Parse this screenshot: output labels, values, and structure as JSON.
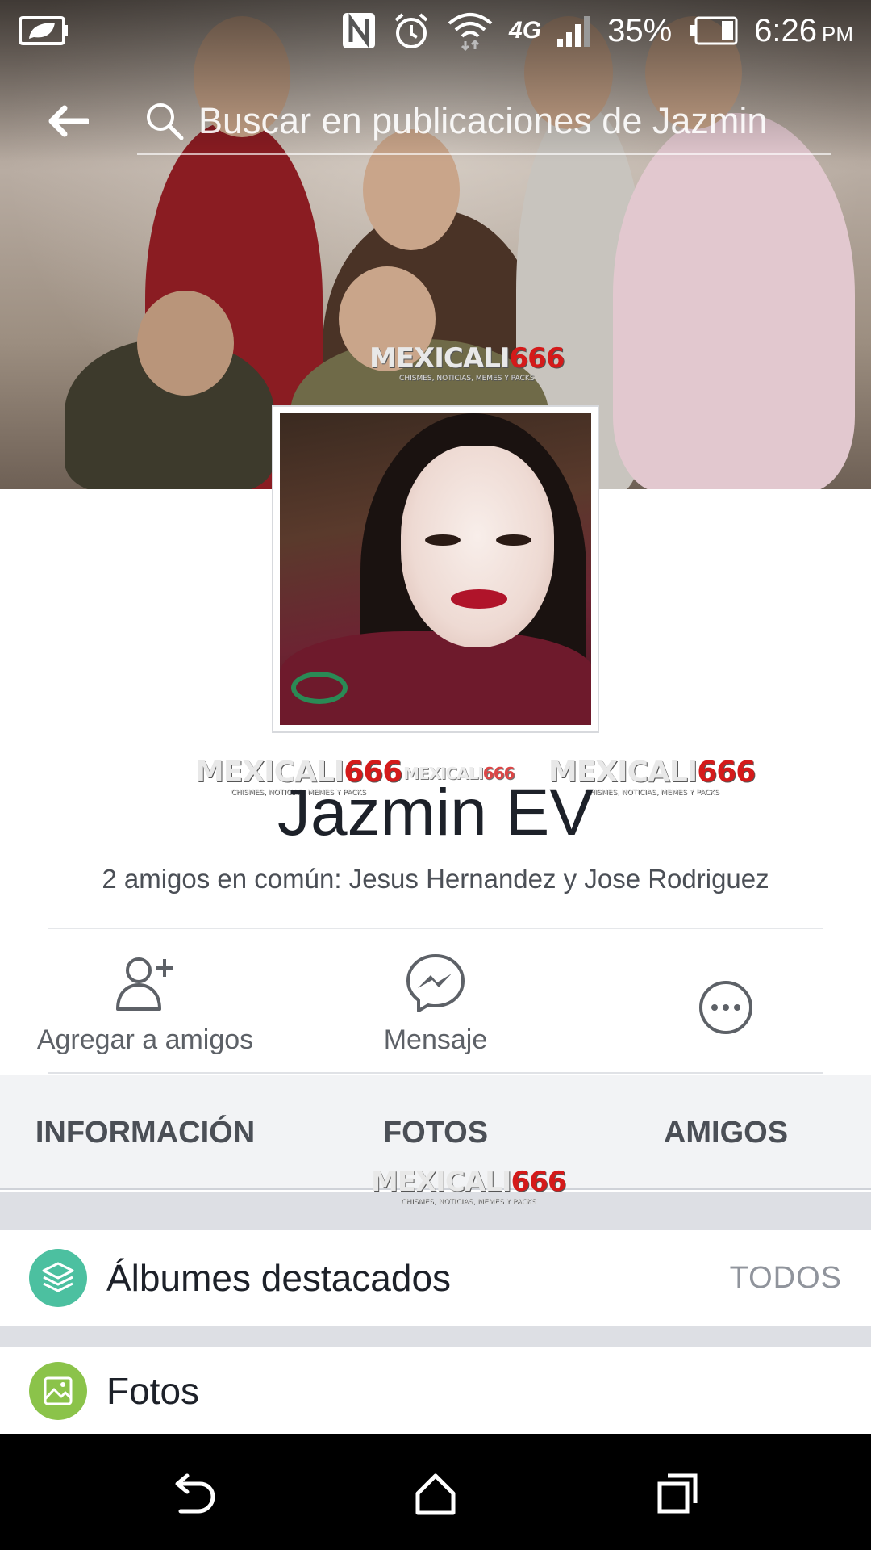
{
  "status_bar": {
    "battery_percent": "35%",
    "time": "6:26",
    "ampm": "PM",
    "network": "4G",
    "icons": [
      "leaf-battery-saver-icon",
      "nfc-icon",
      "alarm-icon",
      "wifi-icon",
      "signal-icon",
      "battery-icon"
    ]
  },
  "header": {
    "back_icon": "back-arrow-icon",
    "search_placeholder": "Buscar en publicaciones de Jazmin"
  },
  "cover": {
    "watermarks": [
      "MEXICALI",
      "666",
      "CHISMES, NOTICIAS, MEMES Y PACKS"
    ]
  },
  "profile": {
    "name": "Jazmin EV",
    "mutual_friends": "2 amigos en común: Jesus Hernandez y Jose Rodriguez"
  },
  "actions": [
    {
      "label": "Agregar a amigos",
      "icon": "add-friend-icon"
    },
    {
      "label": "Mensaje",
      "icon": "messenger-icon"
    },
    {
      "label": "",
      "icon": "more-options-icon"
    }
  ],
  "tabs": [
    "INFORMACIÓN",
    "FOTOS",
    "AMIGOS"
  ],
  "sections": [
    {
      "title": "Álbumes destacados",
      "action": "TODOS",
      "icon": "albums-icon",
      "color": "#4cc0a0"
    },
    {
      "title": "Fotos",
      "action": "",
      "icon": "photos-icon",
      "color": "#8bc34a"
    }
  ],
  "navbar": {
    "icons": [
      "back-nav-icon",
      "home-nav-icon",
      "recents-nav-icon"
    ]
  },
  "colors": {
    "text_primary": "#1d2129",
    "text_secondary": "#4b4f56",
    "tab_bg": "#f2f3f5",
    "separator": "#dddfe4"
  }
}
